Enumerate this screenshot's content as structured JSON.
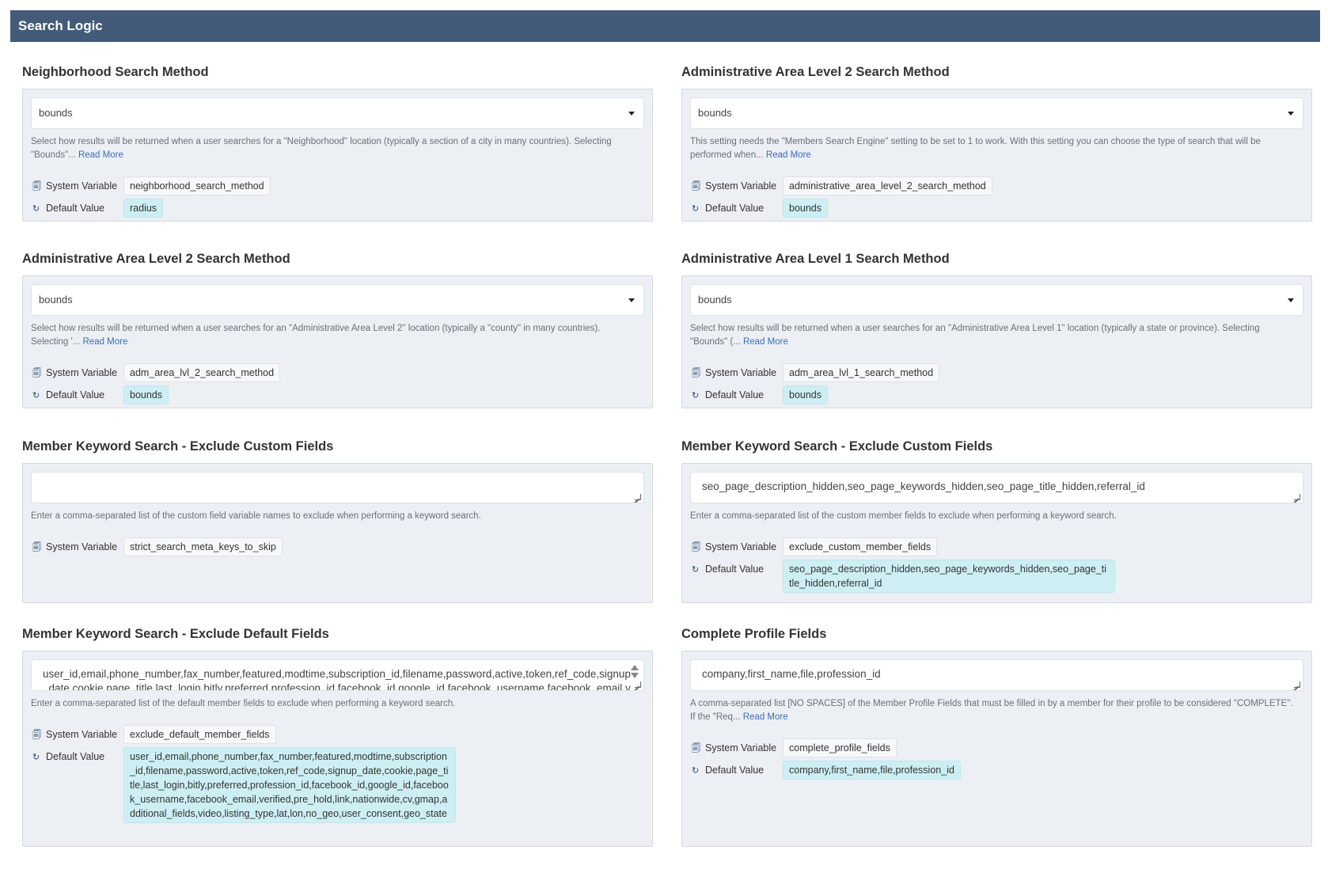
{
  "header": {
    "title": "Search Logic"
  },
  "common": {
    "system_variable_label": "System Variable",
    "default_value_label": "Default Value",
    "read_more": "Read More"
  },
  "panels": [
    {
      "title": "Neighborhood Search Method",
      "value": "bounds",
      "description": "Select how results will be returned when a user searches for a \"Neighborhood\" location (typically a section of a city in many countries). Selecting \"Bounds\"... ",
      "system_variable": "neighborhood_search_method",
      "default_value": "radius"
    },
    {
      "title": "Administrative Area Level 2 Search Method",
      "value": "bounds",
      "description": "This setting needs the \"Members Search Engine\" setting to be set to 1 to work. With this setting you can choose the type of search that will be performed when... ",
      "system_variable": "administrative_area_level_2_search_method",
      "default_value": "bounds"
    },
    {
      "title": "Administrative Area Level 2 Search Method",
      "value": "bounds",
      "description": "Select how results will be returned when a user searches for an \"Administrative Area Level 2\" location (typically a \"county\" in many countries). Selecting '... ",
      "system_variable": "adm_area_lvl_2_search_method",
      "default_value": "bounds"
    },
    {
      "title": "Administrative Area Level 1 Search Method",
      "value": "bounds",
      "description": "Select how results will be returned when a user searches for an \"Administrative Area Level 1\" location (typically a state or province). Selecting \"Bounds\" (... ",
      "system_variable": "adm_area_lvl_1_search_method",
      "default_value": "bounds"
    },
    {
      "title": "Member Keyword Search - Exclude Custom Fields",
      "value": "",
      "description": "Enter a comma-separated list of the custom field variable names to exclude when performing a keyword search.",
      "system_variable": "strict_search_meta_keys_to_skip"
    },
    {
      "title": "Member Keyword Search - Exclude Custom Fields",
      "value": "seo_page_description_hidden,seo_page_keywords_hidden,seo_page_title_hidden,referral_id",
      "description": "Enter a comma-separated list of the custom member fields to exclude when performing a keyword search.",
      "system_variable": "exclude_custom_member_fields",
      "default_value": "seo_page_description_hidden,seo_page_keywords_hidden,seo_page_title_hidden,referral_id"
    },
    {
      "title": "Member Keyword Search - Exclude Default Fields",
      "value": "user_id,email,phone_number,fax_number,featured,modtime,subscription_id,filename,password,active,token,ref_code,signup_date,cookie,page_title,last_login,bitly,preferred,profession_id,facebook_id,google_id,facebook_username,facebook_email,verified,pre_hold,link,nationwide,cv,gmap,additional_fields,video,listing_type,lat,lon,no_geo,user_consent,geo_state",
      "description": "Enter a comma-separated list of the default member fields to exclude when performing a keyword search.",
      "system_variable": "exclude_default_member_fields",
      "default_value": "user_id,email,phone_number,fax_number,featured,modtime,subscription_id,filename,password,active,token,ref_code,signup_date,cookie,page_title,last_login,bitly,preferred,profession_id,facebook_id,google_id,facebook_username,facebook_email,verified,pre_hold,link,nationwide,cv,gmap,additional_fields,video,listing_type,lat,lon,no_geo,user_consent,geo_state"
    },
    {
      "title": "Complete Profile Fields",
      "value": "company,first_name,file,profession_id",
      "description": "A comma-separated list [NO SPACES] of the Member Profile Fields that must be filled in by a member for their profile to be considered \"COMPLETE\". If the \"Req... ",
      "system_variable": "complete_profile_fields",
      "default_value": "company,first_name,file,profession_id"
    }
  ],
  "icons": {
    "system_variable": "copy-icon",
    "default_value": "refresh-icon"
  },
  "colors": {
    "header_bg": "#435b78",
    "card_bg": "#eceff4",
    "default_chip_bg": "#cdeff3",
    "link": "#3b6db3"
  }
}
